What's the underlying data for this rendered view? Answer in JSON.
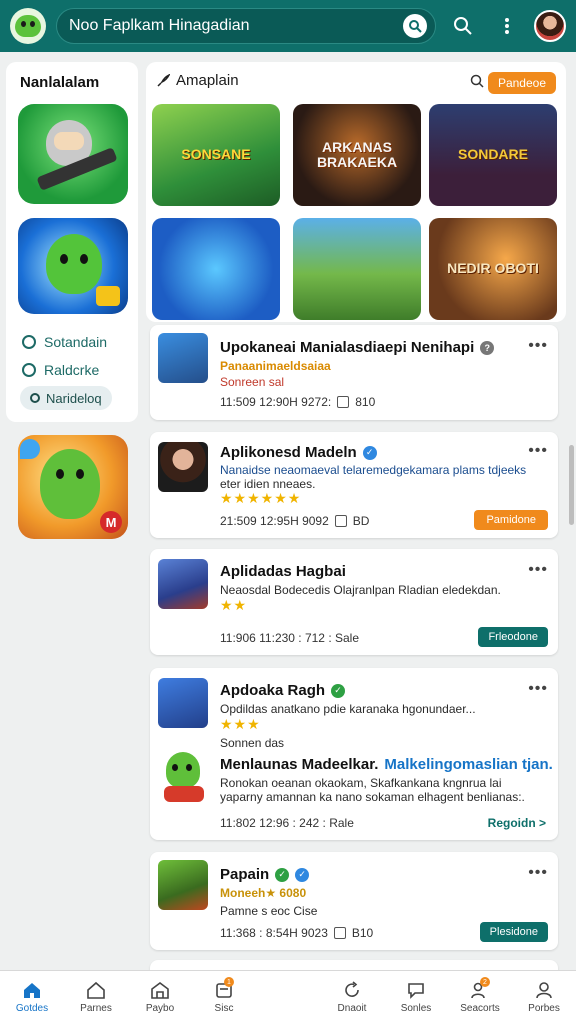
{
  "header": {
    "search_text": "Noo Faplkam Hinagadian"
  },
  "left": {
    "title": "Nanlalalam",
    "links": [
      "Sotandain",
      "Raldcrke"
    ],
    "chip": "Narideloq",
    "tile_badge": "M"
  },
  "featured": {
    "title": "Amaplain",
    "button": "Pandeoe",
    "games": [
      "SONSANE",
      "ARKANAS BRAKAEKA",
      "SONDARE",
      "",
      "",
      "NEDIR OBOTI"
    ]
  },
  "cards": [
    {
      "title": "Upokaneai Manialasdiaepi Nenihapi",
      "sub1": "Panaanimaeldsaiaa",
      "sub2": "Sonreen sal",
      "meta": "11:509 12:90H 9272:",
      "meta_end": "810"
    },
    {
      "title": "Aplikonesd Madeln",
      "desc1": "Nanaidse neaomaeval telaremedgekamara plams tdjeeks",
      "desc2": "eter idien nneaes.",
      "stars": "★★★★★★",
      "meta": "21:509 12:95H 9092",
      "meta_end": "BD",
      "button": "Pamidone"
    },
    {
      "title": "Aplidadas Hagbai",
      "desc1": "Neaosdal Bodecedis Olajranlpan Rladian eledekdan.",
      "stars": "★★",
      "meta": "11:906 11:230 : 712 : Sale",
      "button": "Frleodone"
    },
    {
      "title": "Apdoaka Ragh",
      "desc1": "Opdildas anatkano pdie karanaka hgonundaer...",
      "stars": "★★★",
      "sub": "Sonnen das",
      "title2": "Menlaunas Madeelkar.",
      "title2_accent": "Malkelingomaslian tjan.",
      "desc2": "Ronokan oeanan okaokam, Skafkankana kngnrua lai",
      "desc3": "yaparny amannan ka nano sokaman elhagent benlianas:.",
      "meta": "11:802 12:96 : 242 : Rale",
      "link": "Regoidn >"
    },
    {
      "title": "Papain",
      "sub": "Moneeh★ 6080",
      "sub2": "Pamne s eoc Cise",
      "meta": "11:368 : 8:54H 9023",
      "meta_end": "B10",
      "button": "Plesidone"
    }
  ],
  "nav": [
    {
      "label": "Gotdes",
      "icon": "home-icon",
      "active": true
    },
    {
      "label": "Parnes",
      "icon": "house-icon"
    },
    {
      "label": "Paybo",
      "icon": "store-icon"
    },
    {
      "label": "Sisc",
      "icon": "inbox-icon",
      "badge": "1"
    },
    {
      "label": "",
      "icon": "blank"
    },
    {
      "label": "Dnaoit",
      "icon": "refresh-icon"
    },
    {
      "label": "Sonles",
      "icon": "chat-icon"
    },
    {
      "label": "Seacorts",
      "icon": "people-icon",
      "badge": "2"
    },
    {
      "label": "Porbes",
      "icon": "profile-icon"
    }
  ]
}
